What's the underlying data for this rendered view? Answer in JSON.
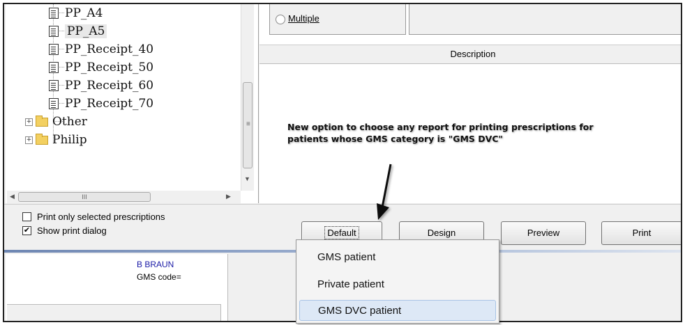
{
  "tree": {
    "items": [
      {
        "label": "PP_A4"
      },
      {
        "label": "PP_A5"
      },
      {
        "label": "PP_Receipt_40"
      },
      {
        "label": "PP_Receipt_50"
      },
      {
        "label": "PP_Receipt_60"
      },
      {
        "label": "PP_Receipt_70"
      }
    ],
    "folders": [
      {
        "label": "Other"
      },
      {
        "label": "Philip"
      }
    ]
  },
  "right": {
    "radio_label": "Multiple",
    "description_header": "Description",
    "annotation_line1": "New option to choose any report for printing prescriptions for",
    "annotation_line2": "patients whose GMS category is \"GMS DVC\""
  },
  "bottom": {
    "check_selected_label": "Print only selected prescriptions",
    "check_selected_checked": false,
    "check_dialog_label": "Show print dialog",
    "check_dialog_checked": true,
    "buttons": {
      "default": "Default",
      "design": "Design",
      "preview": "Preview",
      "print": "Print"
    }
  },
  "lower": {
    "brand": "B BRAUN",
    "gms_code": "GMS code="
  },
  "menu": {
    "items": [
      "GMS patient",
      "Private patient",
      "GMS DVC patient"
    ],
    "highlighted": "GMS DVC patient"
  }
}
